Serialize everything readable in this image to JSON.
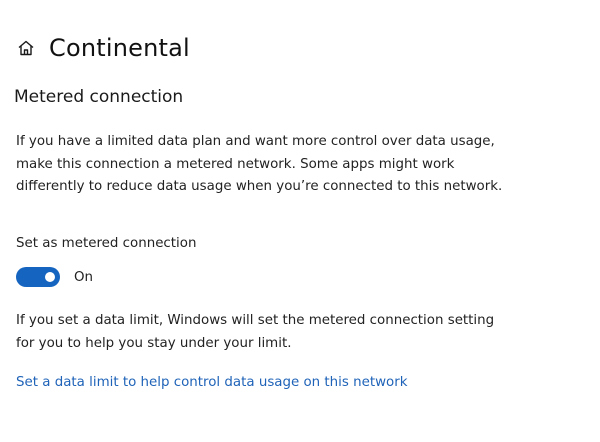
{
  "header": {
    "icon": "home-icon",
    "title": "Continental"
  },
  "section": {
    "title": "Metered connection",
    "description": "If you have a limited data plan and want more control over data usage, make this connection a metered network. Some apps might work differently to reduce data usage when you’re connected to this network."
  },
  "metered_toggle": {
    "label": "Set as metered connection",
    "state_text": "On",
    "is_on": true,
    "accent_color": "#1565c0"
  },
  "data_limit": {
    "info": "If you set a data limit, Windows will set the metered connection setting for you to help you stay under your limit.",
    "link_text": "Set a data limit to help control data usage on this network",
    "link_color": "#1f63b8"
  }
}
